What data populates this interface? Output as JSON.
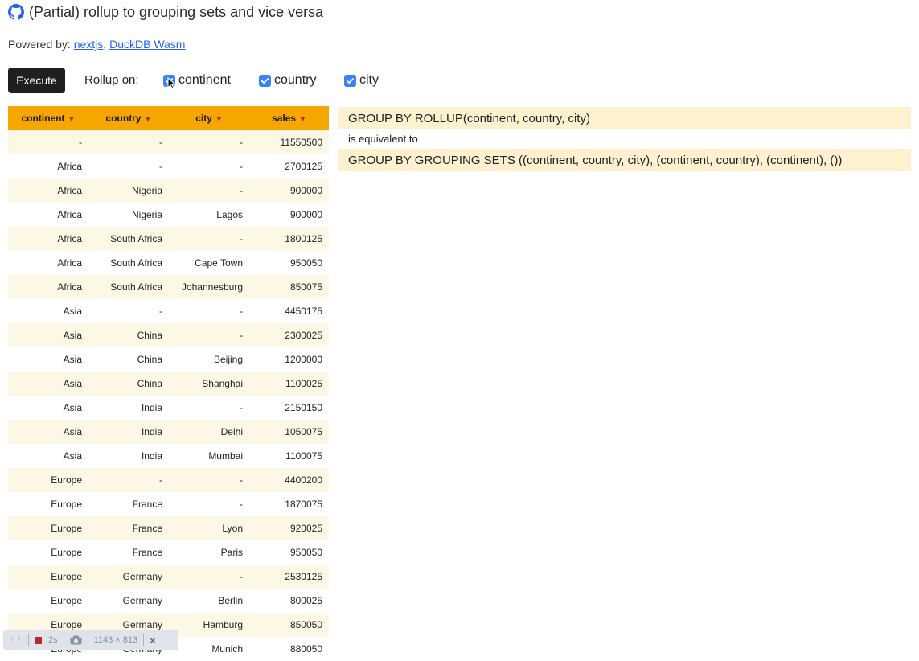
{
  "header": {
    "title": "(Partial) rollup to grouping sets and vice versa",
    "powered_by_label": "Powered by:",
    "links": [
      "nextjs",
      "DuckDB Wasm"
    ],
    "link_separator": ","
  },
  "toolbar": {
    "execute_label": "Execute",
    "rollup_label": "Rollup on:",
    "checkboxes": [
      {
        "label": "continent",
        "checked": true
      },
      {
        "label": "country",
        "checked": true
      },
      {
        "label": "city",
        "checked": true
      }
    ]
  },
  "table": {
    "columns": [
      "continent",
      "country",
      "city",
      "sales"
    ],
    "rows": [
      [
        "-",
        "-",
        "-",
        "11550500"
      ],
      [
        "Africa",
        "-",
        "-",
        "2700125"
      ],
      [
        "Africa",
        "Nigeria",
        "-",
        "900000"
      ],
      [
        "Africa",
        "Nigeria",
        "Lagos",
        "900000"
      ],
      [
        "Africa",
        "South Africa",
        "-",
        "1800125"
      ],
      [
        "Africa",
        "South Africa",
        "Cape Town",
        "950050"
      ],
      [
        "Africa",
        "South Africa",
        "Johannesburg",
        "850075"
      ],
      [
        "Asia",
        "-",
        "-",
        "4450175"
      ],
      [
        "Asia",
        "China",
        "-",
        "2300025"
      ],
      [
        "Asia",
        "China",
        "Beijing",
        "1200000"
      ],
      [
        "Asia",
        "China",
        "Shanghai",
        "1100025"
      ],
      [
        "Asia",
        "India",
        "-",
        "2150150"
      ],
      [
        "Asia",
        "India",
        "Delhi",
        "1050075"
      ],
      [
        "Asia",
        "India",
        "Mumbai",
        "1100075"
      ],
      [
        "Europe",
        "-",
        "-",
        "4400200"
      ],
      [
        "Europe",
        "France",
        "-",
        "1870075"
      ],
      [
        "Europe",
        "France",
        "Lyon",
        "920025"
      ],
      [
        "Europe",
        "France",
        "Paris",
        "950050"
      ],
      [
        "Europe",
        "Germany",
        "-",
        "2530125"
      ],
      [
        "Europe",
        "Germany",
        "Berlin",
        "800025"
      ],
      [
        "Europe",
        "Germany",
        "Hamburg",
        "850050"
      ],
      [
        "Europe",
        "Germany",
        "Munich",
        "880050"
      ]
    ]
  },
  "sql": {
    "rollup": "GROUP BY ROLLUP(continent, country, city)",
    "equivalent": "is equivalent to",
    "grouping_sets": "GROUP BY GROUPING SETS ((continent, country, city), (continent, country), (continent), ())"
  },
  "devbar": {
    "duration": "2s",
    "dimensions": "1143 × 813",
    "close": "×"
  },
  "colors": {
    "header_bg": "#f5a700",
    "sort_arrow": "#c81e1e",
    "row_alt": "#fdf8e6",
    "sql_bg": "#fdf1cf",
    "checkbox": "#3b82f6",
    "link": "#2563eb"
  },
  "icons": {
    "title_icon": "github-icon",
    "sort_icon": "caret-down-icon",
    "check_icon": "check-icon"
  }
}
